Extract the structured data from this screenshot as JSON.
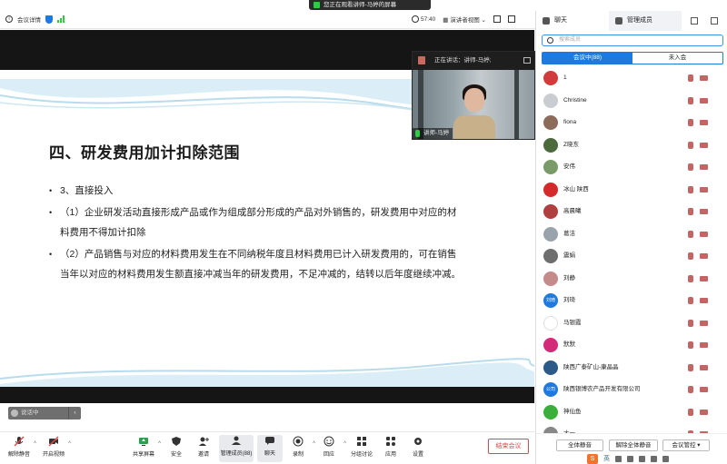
{
  "screen_banner": "您正在观看讲师-马婷的屏幕",
  "topbar": {
    "meeting_info": "会议详情",
    "timer": "57:40",
    "view_mode": "演讲者视图"
  },
  "slide": {
    "title": "四、研发费用加计扣除范围",
    "bullets": [
      {
        "line1": "3、直接投入",
        "line2": ""
      },
      {
        "line1": "（1）企业研发活动直接形成产品或作为组成部分形成的产品对外销售的，研发费用中对应的材",
        "line2": "料费用不得加计扣除"
      },
      {
        "line1": "（2）产品销售与对应的材料费用发生在不同纳税年度且材料费用已计入研发费用的，可在销售",
        "line2": "当年以对应的材料费用发生额直接冲减当年的研发费用，不足冲减的，结转以后年度继续冲减。"
      }
    ],
    "stage_pill": "说话中"
  },
  "video": {
    "speaking_label": "正在讲话：讲师-马婷;",
    "name": "讲师-马婷"
  },
  "toolbar": {
    "mute": "解除静音",
    "video": "开启视频",
    "share": "共享屏幕",
    "security": "安全",
    "invite": "邀请",
    "members": "管理成员(88)",
    "chat": "聊天",
    "record": "录制",
    "react": "回应",
    "breakout": "分组讨论",
    "apps": "应用",
    "settings": "设置",
    "end": "结束会议"
  },
  "panel": {
    "tab_chat": "聊天",
    "tab_members": "管理成员",
    "search_placeholder": "搜索成员",
    "seg_in": "会议中(88)",
    "seg_not": "未入会",
    "members": [
      {
        "name": "1",
        "color": "#d13b3b"
      },
      {
        "name": "Christine",
        "color": "#c9ccd1"
      },
      {
        "name": "fiona",
        "color": "#8c6b5a"
      },
      {
        "name": "Z晓东",
        "color": "#4c6a3c"
      },
      {
        "name": "安伟",
        "color": "#7a9a6a"
      },
      {
        "name": "冰山  陕西",
        "color": "#d42a2a"
      },
      {
        "name": "高晨曦",
        "color": "#b04040"
      },
      {
        "name": "葛洁",
        "color": "#9aa3ab"
      },
      {
        "name": "震娟",
        "color": "#6e6e6e"
      },
      {
        "name": "刘静",
        "color": "#c58a8a"
      },
      {
        "name": "刘琦",
        "color": "#1f7ae0",
        "initials": "刘琦"
      },
      {
        "name": "马银霞",
        "color": "#ffffff"
      },
      {
        "name": "默默",
        "color": "#d42a7a"
      },
      {
        "name": "陕西广泰矿山-康晶晶",
        "color": "#2e5a8a"
      },
      {
        "name": "陕西银博农产品开发有限公司",
        "color": "#1f7ae0",
        "initials": "公司"
      },
      {
        "name": "神仙鱼",
        "color": "#3ab03a"
      },
      {
        "name": "大一",
        "color": "#888888"
      }
    ],
    "btn_mute_all": "全体静音",
    "btn_unmute_all": "解除全体静音",
    "btn_control": "会议管控"
  },
  "ime": {
    "lang": "英"
  }
}
